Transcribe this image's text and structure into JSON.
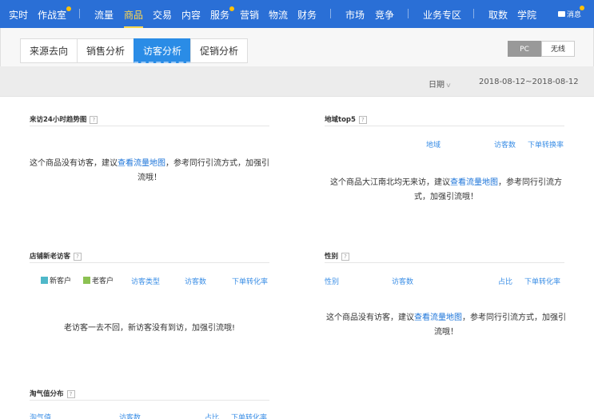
{
  "nav": {
    "items": [
      "实时",
      "作战室",
      "流量",
      "商品",
      "交易",
      "内容",
      "服务",
      "营销",
      "物流",
      "财务",
      "市场",
      "竞争",
      "业务专区",
      "取数",
      "学院"
    ],
    "message": "消息",
    "active_color": "#ffd84d",
    "bg_color": "#2a6fd6"
  },
  "tabs": [
    "来源去向",
    "销售分析",
    "访客分析",
    "促销分析"
  ],
  "device": [
    "PC",
    "无线"
  ],
  "date": {
    "label": "日期",
    "range": "2018-08-12~2018-08-12"
  },
  "panels": {
    "hourly": {
      "title": "来访24小时趋势图",
      "help": "?",
      "empty_pre": "这个商品没有访客，建议",
      "empty_link": "查看流量地图",
      "empty_post": "，参考同行引流方式，加强引流哦！"
    },
    "region": {
      "title": "地域top5",
      "help": "?",
      "columns": [
        "地域",
        "访客数",
        "下单转换率"
      ],
      "empty_pre": "这个商品大江南北均无来访，建议",
      "empty_link": "查看流量地图",
      "empty_post": "，参考同行引流方式，加强引流哦！"
    },
    "newold": {
      "title": "店铺新老访客",
      "help": "?",
      "legend": [
        {
          "label": "新客户",
          "color": "#4fb8c9"
        },
        {
          "label": "老客户",
          "color": "#8cc152"
        }
      ],
      "columns": [
        "访客类型",
        "访客数",
        "下单转化率"
      ],
      "empty": "老访客一去不回，新访客没有到访，加强引流哦!"
    },
    "gender": {
      "title": "性别",
      "help": "?",
      "columns": [
        "性别",
        "访客数",
        "占比",
        "下单转化率"
      ],
      "empty_pre": "这个商品没有访客，建议",
      "empty_link": "查看流量地图",
      "empty_post": "，参考同行引流方式，加强引流哦！"
    },
    "taoqi": {
      "title": "淘气值分布",
      "help": "?",
      "columns": [
        "淘气值",
        "访客数",
        "占比",
        "下单转化率"
      ]
    }
  }
}
